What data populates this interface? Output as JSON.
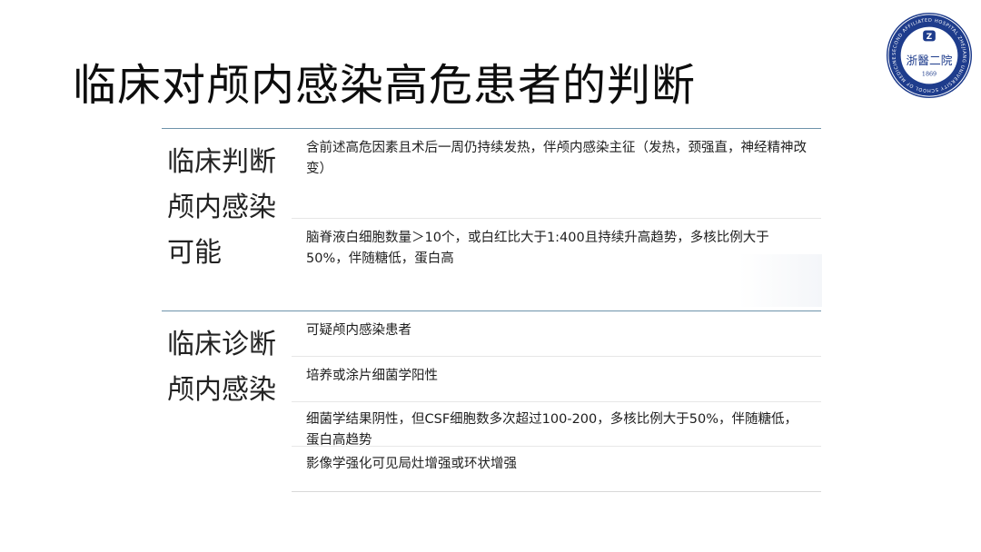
{
  "title": "临床对颅内感染高危患者的判断",
  "logo": {
    "text": "浙醫二院",
    "year": "1869",
    "ring_text": "SECOND AFFILIATED HOSPITAL ZHEJIANG UNIVERSITY SCHOOL OF MEDICINE",
    "colors": {
      "primary": "#1e3c8c",
      "ring_bg": "#ffffff"
    }
  },
  "sections": [
    {
      "label_lines": [
        "临床判断",
        "颅内感染",
        "可能"
      ],
      "rows": [
        "含前述高危因素且术后一周仍持续发热，伴颅内感染主征（发热，颈强直，神经精神改变）",
        "脑脊液白细胞数量＞10个，或白红比大于1:400且持续升高趋势，多核比例大于50%，伴随糖低，蛋白高"
      ]
    },
    {
      "label_lines": [
        "临床诊断",
        "颅内感染"
      ],
      "rows": [
        "可疑颅内感染患者",
        "培养或涂片细菌学阳性",
        "细菌学结果阴性，但CSF细胞数多次超过100-200，多核比例大于50%，伴随糖低，蛋白高趋势",
        "影像学强化可见局灶增强或环状增强"
      ]
    }
  ],
  "colors": {
    "divider": "#6e93aa",
    "row_line": "#e7e7e7"
  }
}
